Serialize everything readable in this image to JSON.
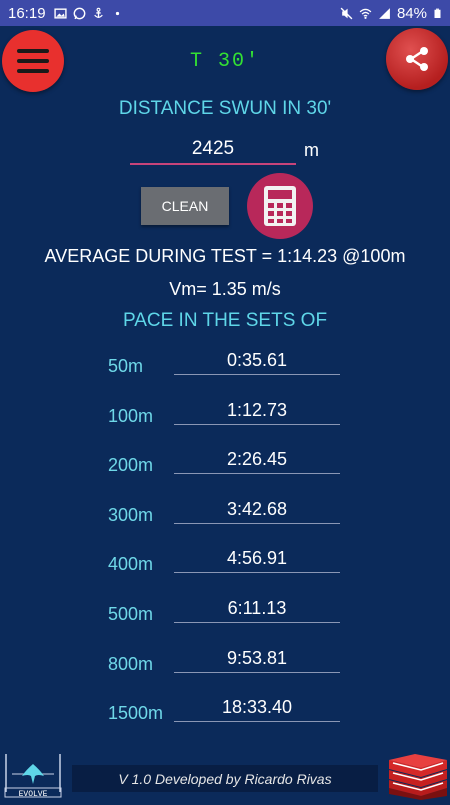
{
  "status_bar": {
    "time": "16:19",
    "battery": "84%",
    "icons": [
      "gallery-icon",
      "whatsapp-icon",
      "anchor-icon",
      "dot-icon",
      "mute-icon",
      "wifi-icon",
      "signal-icon",
      "battery-icon"
    ]
  },
  "header": {
    "title": "T 30'",
    "menu_icon": "hamburger-icon",
    "share_icon": "share-icon"
  },
  "distance": {
    "heading": "DISTANCE SWUN IN 30'",
    "value": "2425",
    "unit": "m"
  },
  "actions": {
    "clean_label": "CLEAN",
    "calculator_icon": "calculator-icon"
  },
  "results": {
    "average": "AVERAGE DURING TEST = 1:14.23 @100m",
    "vm": "Vm= 1.35 m/s",
    "pace_heading": "PACE IN THE SETS OF"
  },
  "paces": [
    {
      "distance": "50m",
      "time": "0:35.61"
    },
    {
      "distance": "100m",
      "time": "1:12.73"
    },
    {
      "distance": "200m",
      "time": "2:26.45"
    },
    {
      "distance": "300m",
      "time": "3:42.68"
    },
    {
      "distance": "400m",
      "time": "4:56.91"
    },
    {
      "distance": "500m",
      "time": "6:11.13"
    },
    {
      "distance": "800m",
      "time": "9:53.81"
    },
    {
      "distance": "1500m",
      "time": "18:33.40"
    }
  ],
  "footer": {
    "logo_text": "EVOLVE",
    "credit": "V 1.0 Developed by Ricardo Rivas",
    "books_icon": "books-icon"
  },
  "colors": {
    "background": "#0b2a5a",
    "status_bar": "#3d4aa8",
    "accent_cyan": "#5fd6e8",
    "timer_green": "#33e033",
    "menu_red": "#e8302e",
    "calc_magenta": "#b8285a"
  }
}
